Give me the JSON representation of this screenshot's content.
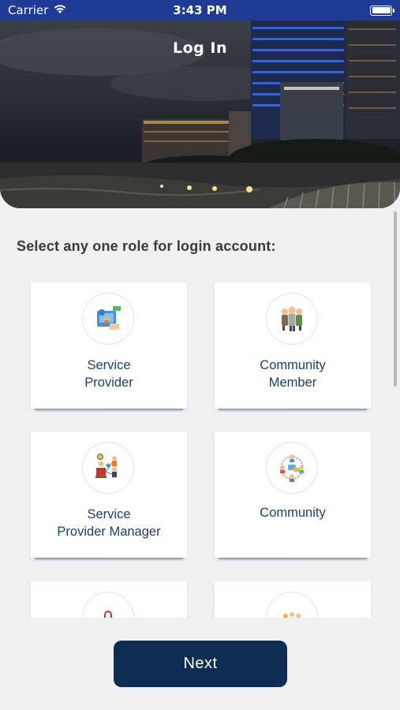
{
  "status_bar": {
    "carrier": "Carrier",
    "time": "3:43 PM"
  },
  "header": {
    "title": "Log In"
  },
  "prompt": "Select any one role for login account:",
  "roles": [
    {
      "line1": "Service",
      "line2": "Provider",
      "icon": "service-provider-icon"
    },
    {
      "line1": "Community",
      "line2": "Member",
      "icon": "community-member-icon"
    },
    {
      "line1": "Service",
      "line2": "Provider Manager",
      "icon": "service-provider-manager-icon"
    },
    {
      "line1": "Community",
      "line2": "",
      "icon": "community-icon"
    },
    {
      "line1": "",
      "line2": "",
      "icon": "lock-icon"
    },
    {
      "line1": "",
      "line2": "",
      "icon": "group-icon"
    }
  ],
  "next_button": "Next",
  "colors": {
    "status_bar": "#1f3b96",
    "label": "#1c3f6e",
    "button": "#0f2d52",
    "background": "#f0f0f0"
  }
}
